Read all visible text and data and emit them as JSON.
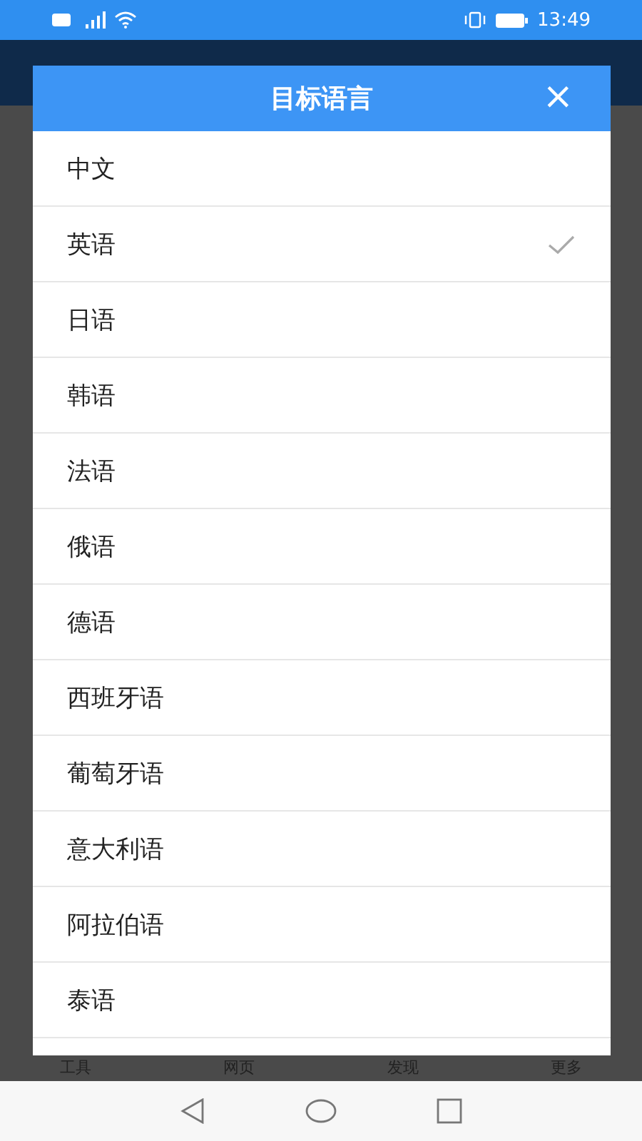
{
  "status_bar": {
    "time": "13:49"
  },
  "dialog": {
    "title": "目标语言",
    "close": "×",
    "items": [
      {
        "label": "中文",
        "selected": false
      },
      {
        "label": "英语",
        "selected": true
      },
      {
        "label": "日语",
        "selected": false
      },
      {
        "label": "韩语",
        "selected": false
      },
      {
        "label": "法语",
        "selected": false
      },
      {
        "label": "俄语",
        "selected": false
      },
      {
        "label": "德语",
        "selected": false
      },
      {
        "label": "西班牙语",
        "selected": false
      },
      {
        "label": "葡萄牙语",
        "selected": false
      },
      {
        "label": "意大利语",
        "selected": false
      },
      {
        "label": "阿拉伯语",
        "selected": false
      },
      {
        "label": "泰语",
        "selected": false
      }
    ]
  },
  "bottom_tabs": [
    "工具",
    "网页",
    "发现",
    "更多"
  ]
}
